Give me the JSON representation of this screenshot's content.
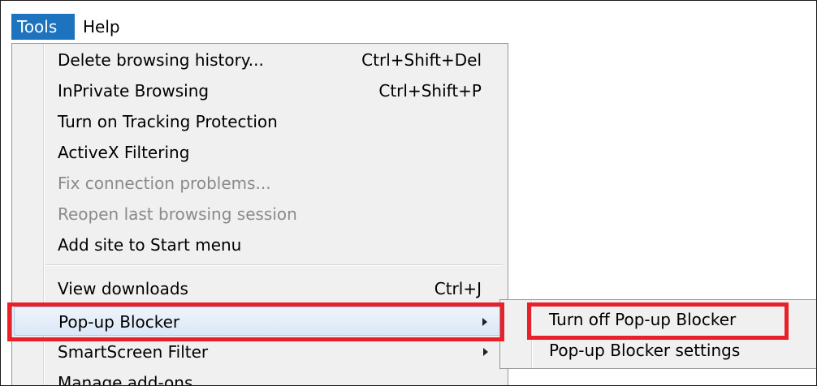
{
  "menubar": {
    "items": [
      {
        "label": "Tools",
        "active": true
      },
      {
        "label": "Help",
        "active": false
      }
    ]
  },
  "tools_menu": {
    "items": [
      {
        "label": "Delete browsing history...",
        "shortcut": "Ctrl+Shift+Del",
        "disabled": false
      },
      {
        "label": "InPrivate Browsing",
        "shortcut": "Ctrl+Shift+P",
        "disabled": false
      },
      {
        "label": "Turn on Tracking Protection",
        "shortcut": "",
        "disabled": false
      },
      {
        "label": "ActiveX Filtering",
        "shortcut": "",
        "disabled": false
      },
      {
        "label": "Fix connection problems...",
        "shortcut": "",
        "disabled": true
      },
      {
        "label": "Reopen last browsing session",
        "shortcut": "",
        "disabled": true
      },
      {
        "label": "Add site to Start menu",
        "shortcut": "",
        "disabled": false
      },
      {
        "label": "View downloads",
        "shortcut": "Ctrl+J",
        "disabled": false
      },
      {
        "label": "Pop-up Blocker",
        "shortcut": "",
        "disabled": false,
        "has_submenu": true,
        "hovered": true
      },
      {
        "label": "SmartScreen Filter",
        "shortcut": "",
        "disabled": false,
        "has_submenu": true
      },
      {
        "label": "Manage add-ons",
        "shortcut": "",
        "disabled": false
      }
    ]
  },
  "popup_blocker_submenu": {
    "items": [
      {
        "label": "Turn off Pop-up Blocker"
      },
      {
        "label": "Pop-up Blocker settings"
      }
    ]
  },
  "colors": {
    "menubar_active_bg": "#1e73be",
    "menu_bg": "#f0f0f0",
    "disabled_text": "#8a8a8a",
    "annotation_red": "#e8202a"
  },
  "icons": {
    "submenu_arrow": "chevron-right-icon"
  }
}
